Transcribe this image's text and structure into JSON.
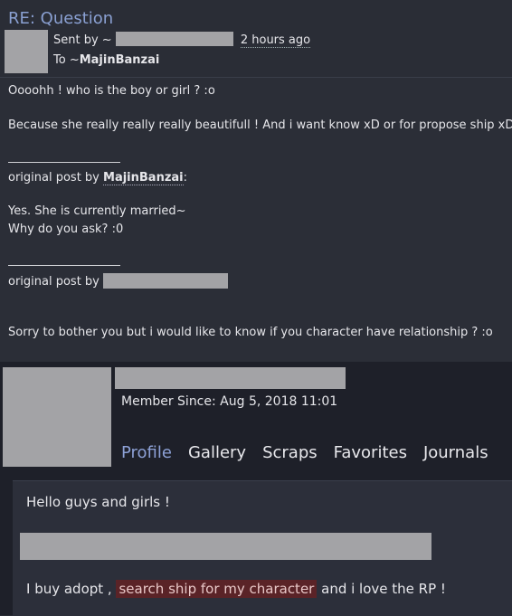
{
  "message": {
    "title": "RE: Question",
    "sent_by_label": "Sent by ~",
    "time": "2 hours ago",
    "to_label": "To ~",
    "to_user": "MajinBanzai"
  },
  "body": {
    "line1": "Oooohh ! who is the boy or girl ? :o",
    "line2": "Because she really really really beautifull ! And i want know xD or for propose ship xD",
    "orig1_prefix": "original post by ",
    "orig1_user": "MajinBanzai",
    "orig1_suffix": ":",
    "line3": "Yes. She is currently married~",
    "line4": "Why do you ask? :0",
    "orig2_prefix": "original post by",
    "line5": "Sorry to bother you but i would like to know if you character have relationship ? :o"
  },
  "profile": {
    "member_since": "Member Since: Aug 5, 2018 11:01",
    "nav": [
      "Profile",
      "Gallery",
      "Scraps",
      "Favorites",
      "Journals"
    ],
    "bio_greeting": "Hello guys and girls !",
    "bio_pre": "I buy adopt ,",
    "bio_highlight": "search ship for my character",
    "bio_post": "and i love the RP !"
  },
  "colors": {
    "accent": "#8da1d6",
    "background": "#2a2d36",
    "profile_background": "#1e2029",
    "highlight": "#5a2327",
    "redaction": "#a3a3a6"
  }
}
